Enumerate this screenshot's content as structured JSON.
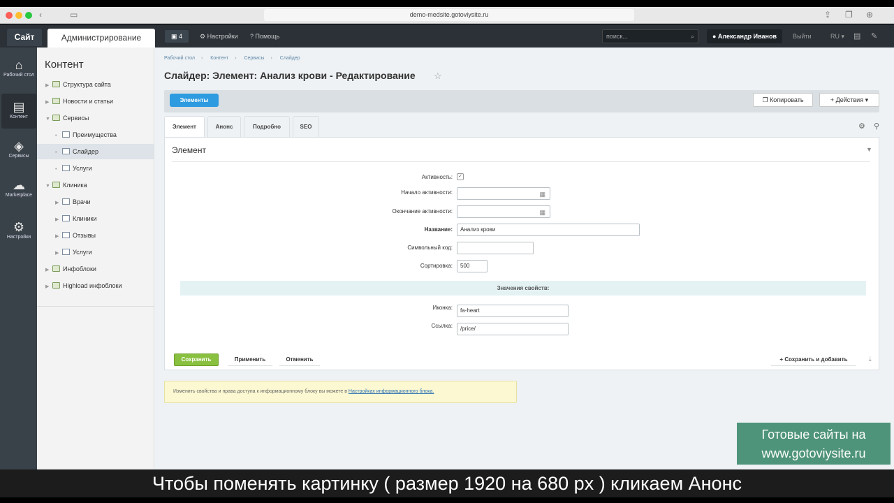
{
  "browser": {
    "url": "demo-medsite.gotoviysite.ru"
  },
  "topbar": {
    "site_label": "Сайт",
    "admin_label": "Администрирование",
    "notifications_count": "4",
    "settings_label": "Настройки",
    "help_label": "Помощь",
    "search_placeholder": "поиск...",
    "user_name": "Александр Иванов",
    "logout_label": "Выйти",
    "language": "RU"
  },
  "leftbar": {
    "items": [
      {
        "label": "Рабочий стол",
        "icon": "home-icon"
      },
      {
        "label": "Контент",
        "icon": "document-icon"
      },
      {
        "label": "Сервисы",
        "icon": "layers-icon"
      },
      {
        "label": "Marketplace",
        "icon": "cloud-icon"
      },
      {
        "label": "Настройки",
        "icon": "gear-icon"
      }
    ]
  },
  "tree": {
    "title": "Контент",
    "items": [
      {
        "label": "Структура сайта"
      },
      {
        "label": "Новости и статьи"
      },
      {
        "label": "Сервисы"
      },
      {
        "label": "Преимущества"
      },
      {
        "label": "Слайдер"
      },
      {
        "label": "Услуги"
      },
      {
        "label": "Клиника"
      },
      {
        "label": "Врачи"
      },
      {
        "label": "Клиники"
      },
      {
        "label": "Отзывы"
      },
      {
        "label": "Услуги"
      },
      {
        "label": "Инфоблоки"
      },
      {
        "label": "Highload инфоблоки"
      }
    ]
  },
  "breadcrumb": [
    "Рабочий стол",
    "Контент",
    "Сервисы",
    "Слайдер"
  ],
  "page": {
    "title": "Слайдер: Элемент: Анализ крови - Редактирование"
  },
  "toolbar": {
    "elements_label": "Элементы",
    "copy_label": "Копировать",
    "actions_label": "Действия"
  },
  "tabs": [
    "Элемент",
    "Анонс",
    "Подробно",
    "SEO"
  ],
  "form": {
    "section_title": "Элемент",
    "active_label": "Активность:",
    "start_label": "Начало активности:",
    "end_label": "Окончание активности:",
    "name_label": "Название:",
    "name_value": "Анализ крови",
    "code_label": "Символьный код:",
    "code_value": "",
    "sort_label": "Сортировка:",
    "sort_value": "500",
    "props_title": "Значения свойств:",
    "icon_label": "Иконка:",
    "icon_value": "fa-heart",
    "link_label": "Ссылка:",
    "link_value": "/price/",
    "save_label": "Сохранить",
    "apply_label": "Применить",
    "cancel_label": "Отменить",
    "save_add_label": "Сохранить и добавить"
  },
  "note": {
    "text": "Изменить свойства и права доступа к информационному блоку вы можете в",
    "link": "Настройках информационного блока."
  },
  "watermark": {
    "line1": "Готовые сайты на",
    "line2": "www.gotoviysite.ru"
  },
  "subtitle": "Чтобы поменять картинку ( размер 1920 на 680 px ) кликаем Анонс"
}
